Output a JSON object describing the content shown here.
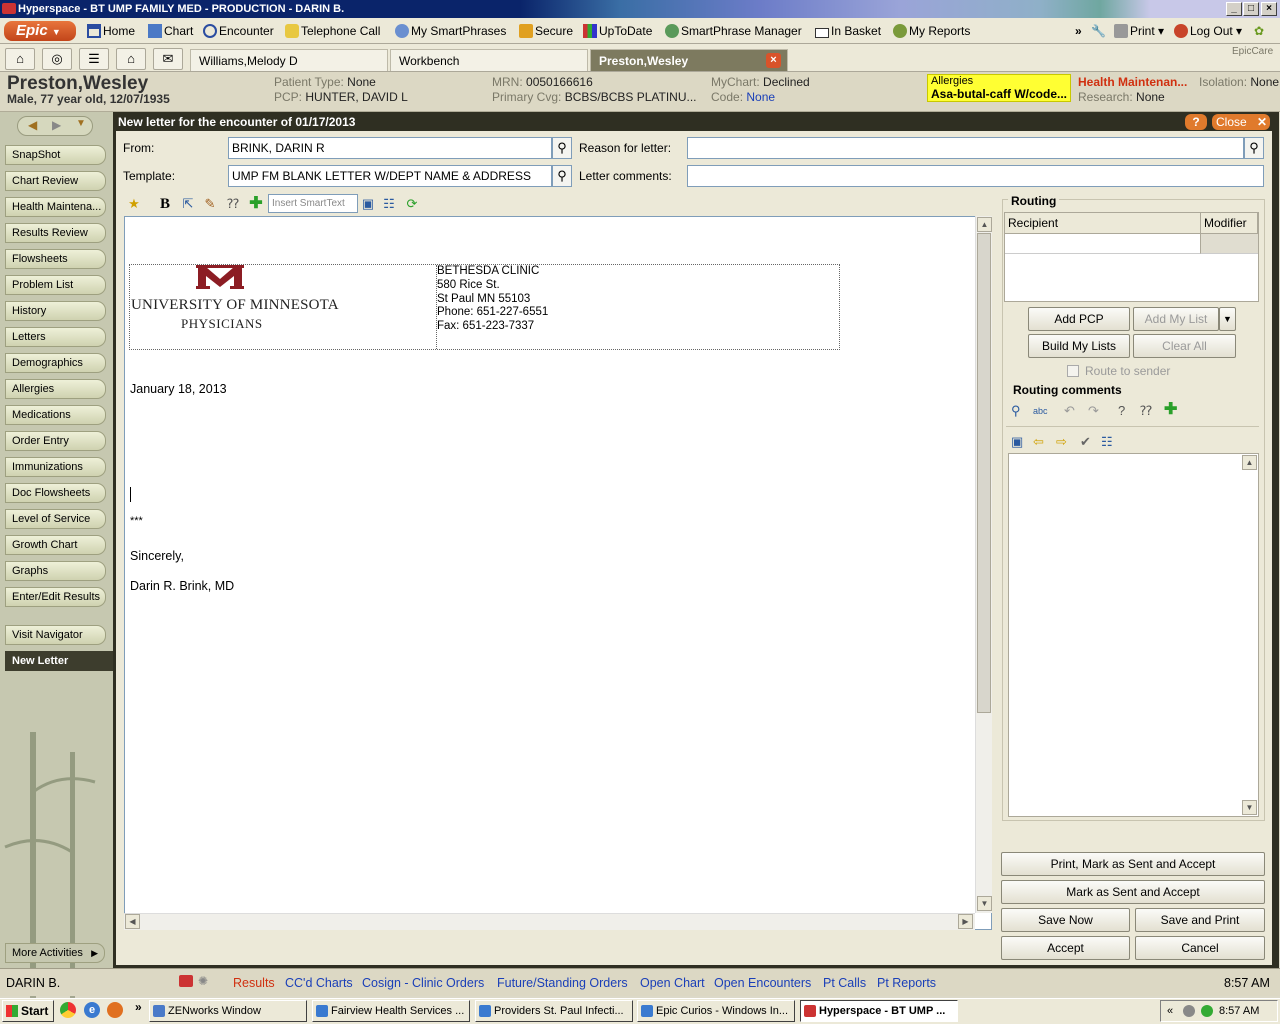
{
  "window": {
    "title": "Hyperspace - BT UMP FAMILY MED - PRODUCTION - DARIN B."
  },
  "toolbar": {
    "epic_label": "Epic",
    "items": [
      "Home",
      "Chart",
      "Encounter",
      "Telephone Call",
      "My SmartPhrases",
      "Secure",
      "UpToDate",
      "SmartPhrase Manager",
      "In Basket",
      "My Reports"
    ],
    "print_label": "Print",
    "logout_label": "Log Out",
    "brand": "EpicCare"
  },
  "tabs": {
    "items": [
      "Williams,Melody D",
      "Workbench",
      "Preston,Wesley"
    ]
  },
  "patient": {
    "name": "Preston,Wesley",
    "demographics": "Male, 77 year old, 12/07/1935",
    "patient_type_label": "Patient Type:",
    "patient_type": "None",
    "pcp_label": "PCP:",
    "pcp": "HUNTER, DAVID L",
    "mrn_label": "MRN:",
    "mrn": "0050166616",
    "coverage_label": "Primary Cvg:",
    "coverage": "BCBS/BCBS PLATINU...",
    "mychart_label": "MyChart:",
    "mychart": "Declined",
    "code_label": "Code:",
    "code": "None",
    "allergies_label": "Allergies",
    "allergies": "Asa-butal-caff W/code...",
    "health_maint": "Health Maintenan...",
    "isolation_label": "Isolation:",
    "isolation": "None",
    "research_label": "Research:",
    "research": "None"
  },
  "sidebar": {
    "items": [
      "SnapShot",
      "Chart Review",
      "Health Maintena...",
      "Results Review",
      "Flowsheets",
      "Problem List",
      "History",
      "Letters",
      "Demographics",
      "Allergies",
      "Medications",
      "Order Entry",
      "Immunizations",
      "Doc Flowsheets",
      "Level of Service",
      "Growth Chart",
      "Graphs",
      "Enter/Edit Results",
      "Visit Navigator",
      "New Letter"
    ],
    "more": "More Activities"
  },
  "activity": {
    "title": "New letter for the encounter of 01/17/2013",
    "help": "?",
    "close": "Close"
  },
  "form": {
    "from_label": "From:",
    "from_value": "BRINK, DARIN R",
    "template_label": "Template:",
    "template_value": "UMP FM BLANK LETTER W/DEPT NAME & ADDRESS",
    "reason_label": "Reason for letter:",
    "reason_value": "",
    "comments_label": "Letter comments:",
    "comments_value": "",
    "smarttext_placeholder": "Insert SmartText"
  },
  "letter": {
    "logo_line1": "UNIVERSITY OF MINNESOTA",
    "logo_line2": "PHYSICIANS",
    "clinic": "BETHESDA CLINIC",
    "street": "580 Rice St.",
    "city": "St Paul MN 55103",
    "phone": "Phone: 651-227-6551",
    "fax": "Fax: 651-223-7337",
    "date": "January 18, 2013",
    "placeholder": "***",
    "closing": "Sincerely,",
    "signature": "Darin R. Brink, MD"
  },
  "routing": {
    "title": "Routing",
    "col_recipient": "Recipient",
    "col_modifier": "Modifier",
    "add_pcp": "Add PCP",
    "add_my_list": "Add My List",
    "build_my_lists": "Build My Lists",
    "clear_all": "Clear All",
    "route_to_sender": "Route to sender",
    "comments_title": "Routing comments"
  },
  "actions": {
    "print_mark_sent": "Print, Mark as Sent and Accept",
    "mark_sent": "Mark as Sent and Accept",
    "save_now": "Save Now",
    "save_print": "Save and Print",
    "accept": "Accept",
    "cancel": "Cancel"
  },
  "status": {
    "user": "DARIN B.",
    "links": [
      "Results",
      "CC'd Charts",
      "Cosign - Clinic Orders",
      "Future/Standing Orders",
      "Open Chart",
      "Open Encounters",
      "Pt Calls",
      "Pt Reports"
    ],
    "time": "8:57 AM"
  },
  "taskbar": {
    "start": "Start",
    "tasks": [
      "ZENworks Window",
      "Fairview Health Services ...",
      "Providers St. Paul Infecti...",
      "Epic Curios - Windows In...",
      "Hyperspace - BT UMP ..."
    ],
    "time": "8:57 AM"
  },
  "colors": {
    "accent": "#e07a2c",
    "link": "#1a3fb8",
    "allergy_bg": "#ffff33",
    "health_maint": "#d03010"
  }
}
